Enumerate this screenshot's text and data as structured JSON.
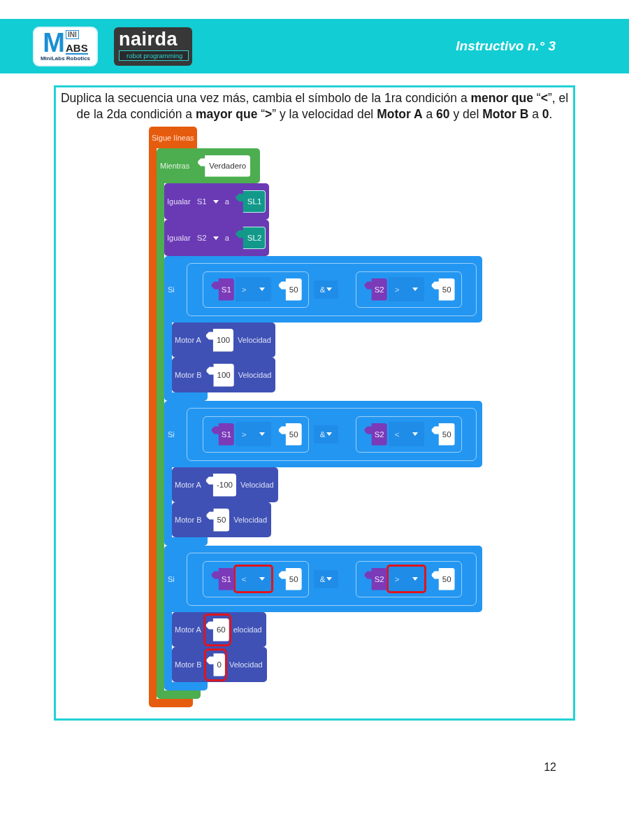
{
  "header": {
    "minilabs_logo": {
      "letter": "M",
      "small_text": "INI",
      "tail_text": "ABS",
      "caption": "MiniLabs Robotics"
    },
    "nairda_logo": {
      "name": "nairda",
      "tagline": "robot programming"
    },
    "title": "Instructivo n.° 3"
  },
  "instruction": "Duplica la secuencia una vez más, cambia el símbolo de la 1ra condición a **menor que** “**<**”, el de la 2da condición a **mayor que** “**>**” y la velocidad del **Motor A** a **60** y del **Motor B** a **0**.",
  "program": {
    "root": {
      "label": "Sigue líneas"
    },
    "loop": {
      "label": "Mientras",
      "condition": "Verdadero"
    },
    "assignments": [
      {
        "label": "Igualar",
        "variable": "S1",
        "connector": "a",
        "sensor": "SL1"
      },
      {
        "label": "Igualar",
        "variable": "S2",
        "connector": "a",
        "sensor": "SL2"
      }
    ],
    "branches": [
      {
        "label": "Si",
        "comparisons": [
          {
            "variable": "S1",
            "operator": ">",
            "value": "50",
            "operator_highlighted": false
          },
          {
            "variable": "S2",
            "operator": ">",
            "value": "50",
            "operator_highlighted": false
          }
        ],
        "joiner": "&",
        "motors": [
          {
            "label": "Motor A",
            "value": "100",
            "unit": "Velocidad",
            "value_highlighted": false
          },
          {
            "label": "Motor B",
            "value": "100",
            "unit": "Velocidad",
            "value_highlighted": false
          }
        ]
      },
      {
        "label": "Si",
        "comparisons": [
          {
            "variable": "S1",
            "operator": ">",
            "value": "50",
            "operator_highlighted": false
          },
          {
            "variable": "S2",
            "operator": "<",
            "value": "50",
            "operator_highlighted": false
          }
        ],
        "joiner": "&",
        "motors": [
          {
            "label": "Motor A",
            "value": "-100",
            "unit": "Velocidad",
            "value_highlighted": false
          },
          {
            "label": "Motor B",
            "value": "50",
            "unit": "Velocidad",
            "value_highlighted": false
          }
        ]
      },
      {
        "label": "Si",
        "comparisons": [
          {
            "variable": "S1",
            "operator": "<",
            "value": "50",
            "operator_highlighted": true
          },
          {
            "variable": "S2",
            "operator": ">",
            "value": "50",
            "operator_highlighted": true
          }
        ],
        "joiner": "&",
        "motors": [
          {
            "label": "Motor A",
            "value": "60",
            "unit": "elocidad",
            "value_highlighted": true
          },
          {
            "label": "Motor B",
            "value": "0",
            "unit": "Velocidad",
            "value_highlighted": true
          }
        ]
      }
    ]
  },
  "page_number": "12"
}
